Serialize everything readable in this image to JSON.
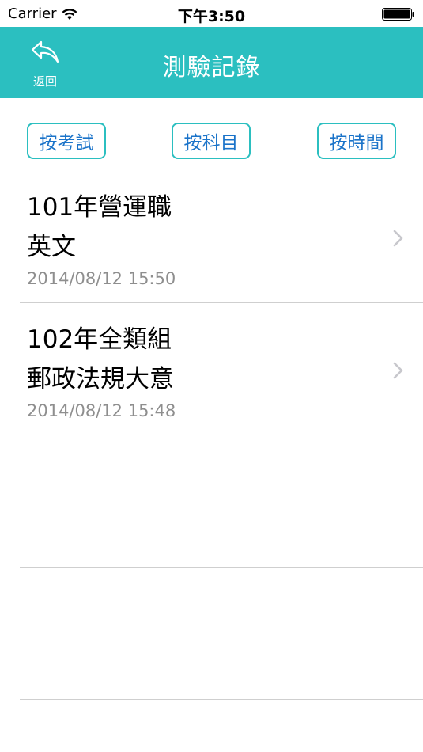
{
  "status_bar": {
    "carrier": "Carrier",
    "time": "下午3:50",
    "wifi_icon": "wifi-icon",
    "battery_icon": "battery-icon"
  },
  "nav": {
    "back_label": "返回",
    "back_icon": "reply-arrow-icon",
    "title": "測驗記錄",
    "color": "#2bbfc0"
  },
  "filters": {
    "by_exam": "按考試",
    "by_subject": "按科目",
    "by_time": "按時間"
  },
  "records": [
    {
      "exam": "101年營運職",
      "subject": "英文",
      "date": "2014/08/12 15:50"
    },
    {
      "exam": "102年全類組",
      "subject": "郵政法規大意",
      "date": "2014/08/12 15:48"
    }
  ]
}
